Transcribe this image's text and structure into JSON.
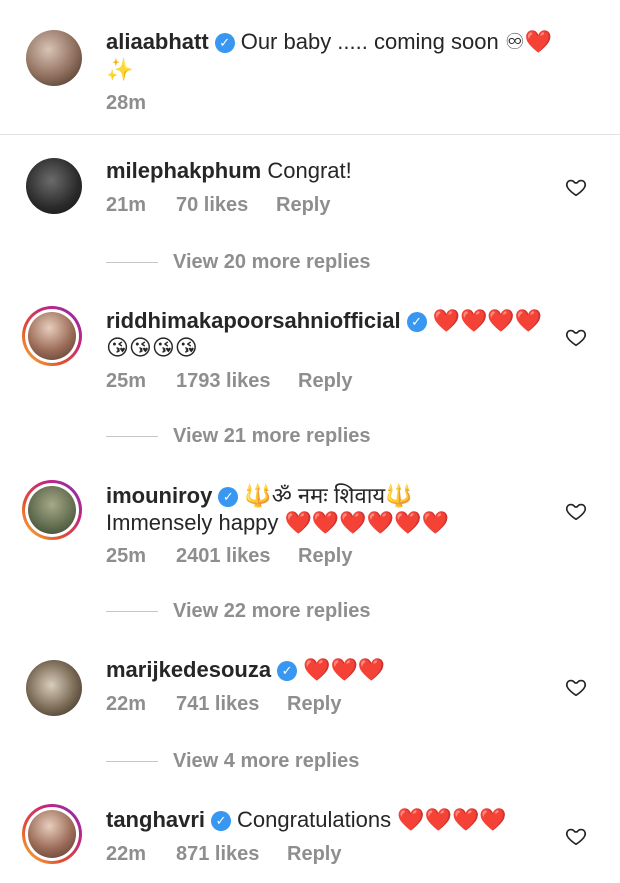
{
  "caption": {
    "username": "aliaabhatt",
    "text": "Our baby ..... coming soon ♾❤️",
    "text_line2": "✨",
    "time": "28m"
  },
  "comments": [
    {
      "username": "milephakphum",
      "verified": false,
      "text": "Congrat!",
      "time": "21m",
      "likes": "70 likes",
      "reply": "Reply",
      "view_replies": "View 20 more replies"
    },
    {
      "username": "riddhimakapoorsahniofficial",
      "verified": true,
      "text": "❤️❤️❤️❤️",
      "text_line2": "😘😘😘😘",
      "time": "25m",
      "likes": "1793 likes",
      "reply": "Reply",
      "view_replies": "View 21 more replies"
    },
    {
      "username": "imouniroy",
      "verified": true,
      "text": "🔱ॐ नमः शिवाय🔱",
      "text_line2": "Immensely happy ❤️❤️❤️❤️❤️❤️",
      "time": "25m",
      "likes": "2401 likes",
      "reply": "Reply",
      "view_replies": "View 22 more replies"
    },
    {
      "username": "marijkedesouza",
      "verified": true,
      "text": "❤️❤️❤️",
      "time": "22m",
      "likes": "741 likes",
      "reply": "Reply",
      "view_replies": "View 4 more replies"
    },
    {
      "username": "tanghavri",
      "verified": true,
      "text": "Congratulations ❤️❤️❤️❤️",
      "time": "22m",
      "likes": "871 likes",
      "reply": "Reply"
    }
  ],
  "icons": {
    "verified": "verified-badge-icon",
    "like": "heart-outline-icon"
  },
  "colors": {
    "verified": "#3897f0",
    "secondary_text": "#8e8e8e",
    "heart": "#e0262b"
  }
}
